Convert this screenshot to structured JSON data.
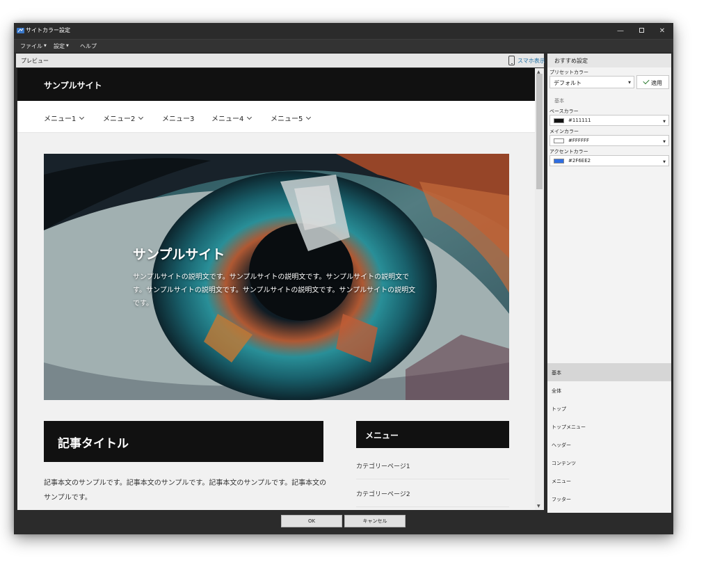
{
  "window": {
    "title": "サイトカラー設定",
    "minimize": "—",
    "close": "✕"
  },
  "menubar": [
    {
      "label": "ファイル",
      "has_caret": true
    },
    {
      "label": "設定",
      "has_caret": true
    },
    {
      "label": "ヘルプ",
      "has_caret": false
    }
  ],
  "preview": {
    "label": "プレビュー",
    "smartphone_label": "スマホ表示",
    "site": {
      "title": "サンプルサイト",
      "nav": [
        "メニュー1",
        "メニュー2",
        "メニュー3",
        "メニュー4",
        "メニュー5"
      ],
      "hero_title": "サンプルサイト",
      "hero_desc": "サンプルサイトの説明文です。サンプルサイトの説明文です。サンプルサイトの説明文です。サンプルサイトの説明文です。サンプルサイトの説明文です。サンプルサイトの説明文です。",
      "article_title": "記事タイトル",
      "article_body": "記事本文のサンプルです。記事本文のサンプルです。記事本文のサンプルです。記事本文のサンプルです。",
      "side_menu_title": "メニュー",
      "categories": [
        "カテゴリーページ1",
        "カテゴリーページ2"
      ]
    }
  },
  "settings": {
    "title": "おすすめ設定",
    "preset_label": "プリセットカラー",
    "preset_value": "デフォルト",
    "apply_label": "適用",
    "section_label": "基本",
    "base_color_label": "ベースカラー",
    "base_color": "#111111",
    "main_color_label": "メインカラー",
    "main_color": "#FFFFFF",
    "accent_color_label": "アクセントカラー",
    "accent_color": "#2F6EE2",
    "categories": [
      "基本",
      "全体",
      "トップ",
      "トップメニュー",
      "ヘッダー",
      "コンテンツ",
      "メニュー",
      "フッター"
    ],
    "active_category": "基本"
  },
  "footer": {
    "ok_label": "OK",
    "cancel_label": "キャンセル"
  },
  "colors": {
    "accent": "#2F6EE2",
    "link": "#1F6EA3",
    "chrome": "#2B2B2B"
  }
}
